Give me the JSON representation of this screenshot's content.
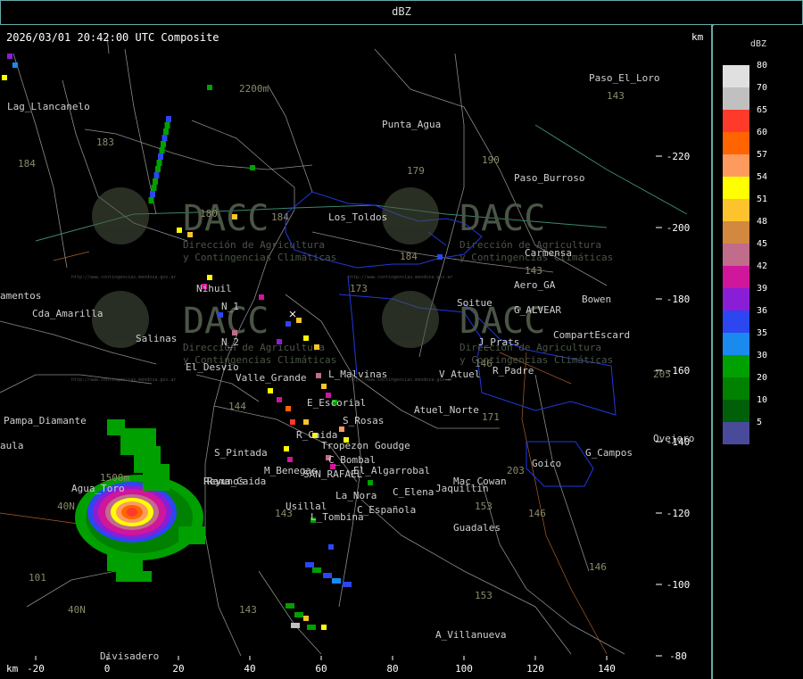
{
  "header": {
    "title": "dBZ"
  },
  "map": {
    "timestamp": "2026/03/01 20:42:00 UTC Composite",
    "km_label": "km",
    "x_axis_label": "km",
    "x_ticks": [
      -20,
      0,
      20,
      40,
      60,
      80,
      100,
      120,
      140
    ],
    "y_ticks": [
      -80,
      -100,
      -120,
      -140,
      -160,
      -180,
      -200,
      -220
    ],
    "watermark_text": "DACC",
    "watermark_subtitle": [
      "Dirección de Agricultura",
      "y Contingencias Climáticas"
    ],
    "watermark_url": "http://www.contingencias.mendoza.gov.ar",
    "places": [
      {
        "name": "Divisadero",
        "x": -2,
        "y": -79
      },
      {
        "name": "A_Villanueva",
        "x": 92,
        "y": -85
      },
      {
        "name": "Guadales",
        "x": 97,
        "y": -115
      },
      {
        "name": "Usillal",
        "x": 50,
        "y": -121
      },
      {
        "name": "L_Tombina",
        "x": 57,
        "y": -118
      },
      {
        "name": "C_Española",
        "x": 70,
        "y": -120
      },
      {
        "name": "La_Nora",
        "x": 64,
        "y": -124
      },
      {
        "name": "C_Elena",
        "x": 80,
        "y": -125
      },
      {
        "name": "Jaquillin",
        "x": 92,
        "y": -126
      },
      {
        "name": "Mac_Cowan",
        "x": 97,
        "y": -128
      },
      {
        "name": "Agua_Toro",
        "x": -10,
        "y": -126
      },
      {
        "name": "Rama_Caida",
        "x": 28,
        "y": -128
      },
      {
        "name": "Reyunos",
        "x": 27,
        "y": -128
      },
      {
        "name": "M_Benegas",
        "x": 44,
        "y": -131
      },
      {
        "name": "SAN_RAFAEL",
        "x": 55,
        "y": -130
      },
      {
        "name": "El_Algarrobal",
        "x": 69,
        "y": -131
      },
      {
        "name": "Goico",
        "x": 119,
        "y": -133
      },
      {
        "name": "G_Campos",
        "x": 134,
        "y": -136
      },
      {
        "name": "Ovejero",
        "x": 153,
        "y": -140
      },
      {
        "name": "S_Pintada",
        "x": 30,
        "y": -136
      },
      {
        "name": "C_Bombal",
        "x": 62,
        "y": -134
      },
      {
        "name": "Tropezon",
        "x": 60,
        "y": -138
      },
      {
        "name": "Goudge",
        "x": 75,
        "y": -138
      },
      {
        "name": "Pampa_Diamante",
        "x": -29,
        "y": -145
      },
      {
        "name": "R_Caida",
        "x": 53,
        "y": -141
      },
      {
        "name": "S_Rosas",
        "x": 66,
        "y": -145
      },
      {
        "name": "Atuel_Norte",
        "x": 86,
        "y": -148
      },
      {
        "name": "E_Escorial",
        "x": 56,
        "y": -150
      },
      {
        "name": "Valle_Grande",
        "x": 36,
        "y": -157
      },
      {
        "name": "L_Malvinas",
        "x": 62,
        "y": -158
      },
      {
        "name": "V_Atuel",
        "x": 93,
        "y": -158
      },
      {
        "name": "R_Padre",
        "x": 108,
        "y": -159
      },
      {
        "name": "El_Desvio",
        "x": 22,
        "y": -160
      },
      {
        "name": "Salinas",
        "x": 8,
        "y": -168
      },
      {
        "name": "N_2",
        "x": 32,
        "y": -167
      },
      {
        "name": "J_Prats",
        "x": 104,
        "y": -167
      },
      {
        "name": "CompartEscard",
        "x": 125,
        "y": -169
      },
      {
        "name": "Cda_Amarilla",
        "x": -21,
        "y": -175
      },
      {
        "name": "N_1",
        "x": 32,
        "y": -177
      },
      {
        "name": "G_ALVEAR",
        "x": 114,
        "y": -176
      },
      {
        "name": "Soitue",
        "x": 98,
        "y": -178
      },
      {
        "name": "Bowen",
        "x": 133,
        "y": -179
      },
      {
        "name": "Nihuil",
        "x": 25,
        "y": -182
      },
      {
        "name": "Aero_GA",
        "x": 114,
        "y": -183
      },
      {
        "name": "Carmensa",
        "x": 117,
        "y": -192
      },
      {
        "name": "Los_Toldos",
        "x": 62,
        "y": -202
      },
      {
        "name": "Paso_Burroso",
        "x": 114,
        "y": -213
      },
      {
        "name": "Punta_Agua",
        "x": 77,
        "y": -228
      },
      {
        "name": "Lag_Llancanelo",
        "x": -28,
        "y": -233
      },
      {
        "name": "Paso_El_Loro",
        "x": 135,
        "y": -241
      },
      {
        "name": "amentos",
        "x": -30,
        "y": -180
      },
      {
        "name": "aula",
        "x": -30,
        "y": -138
      }
    ],
    "route_labels": [
      {
        "name": "40N",
        "x": -11,
        "y": -92
      },
      {
        "name": "101",
        "x": -22,
        "y": -101
      },
      {
        "name": "40N",
        "x": -14,
        "y": -121
      },
      {
        "name": "143",
        "x": 37,
        "y": -92
      },
      {
        "name": "153",
        "x": 103,
        "y": -96
      },
      {
        "name": "146",
        "x": 135,
        "y": -104
      },
      {
        "name": "143",
        "x": 47,
        "y": -119
      },
      {
        "name": "153",
        "x": 103,
        "y": -121
      },
      {
        "name": "146",
        "x": 118,
        "y": -119
      },
      {
        "name": "203",
        "x": 112,
        "y": -131
      },
      {
        "name": "171",
        "x": 105,
        "y": -146
      },
      {
        "name": "144",
        "x": 34,
        "y": -149
      },
      {
        "name": "205",
        "x": 153,
        "y": -158
      },
      {
        "name": "146",
        "x": 103,
        "y": -161
      },
      {
        "name": "173",
        "x": 68,
        "y": -182
      },
      {
        "name": "184",
        "x": 82,
        "y": -191
      },
      {
        "name": "143",
        "x": 117,
        "y": -187
      },
      {
        "name": "184",
        "x": 46,
        "y": -202
      },
      {
        "name": "180",
        "x": 26,
        "y": -203
      },
      {
        "name": "184",
        "x": -25,
        "y": -217
      },
      {
        "name": "179",
        "x": 84,
        "y": -215
      },
      {
        "name": "190",
        "x": 105,
        "y": -218
      },
      {
        "name": "183",
        "x": -3,
        "y": -223
      },
      {
        "name": "143",
        "x": 140,
        "y": -236
      },
      {
        "name": "1500m",
        "x": -2,
        "y": -129
      },
      {
        "name": "2200m",
        "x": 37,
        "y": -238
      }
    ]
  },
  "legend": {
    "title": "dBZ",
    "items": [
      {
        "label": "80",
        "color": "#e0e0e0"
      },
      {
        "label": "70",
        "color": "#c0c0c0"
      },
      {
        "label": "65",
        "color": "#ff3a2a"
      },
      {
        "label": "60",
        "color": "#ff6400"
      },
      {
        "label": "57",
        "color": "#ff9a5e"
      },
      {
        "label": "54",
        "color": "#ffff00"
      },
      {
        "label": "51",
        "color": "#fcc32c"
      },
      {
        "label": "48",
        "color": "#d2883e"
      },
      {
        "label": "45",
        "color": "#c06c8a"
      },
      {
        "label": "42",
        "color": "#d0169a"
      },
      {
        "label": "39",
        "color": "#8a1ed6"
      },
      {
        "label": "36",
        "color": "#2c46f0"
      },
      {
        "label": "35",
        "color": "#1a8aee"
      },
      {
        "label": "30",
        "color": "#00a000"
      },
      {
        "label": "20",
        "color": "#008200"
      },
      {
        "label": "10",
        "color": "#00600a"
      },
      {
        "label": "5",
        "color": "#4a4a9a"
      }
    ]
  },
  "colors": {
    "frame": "#66aaaa",
    "roads": "#9a9a9a",
    "boundary": "#1e32d8",
    "rivers": "#3a8a6a",
    "rail": "#a06030"
  }
}
